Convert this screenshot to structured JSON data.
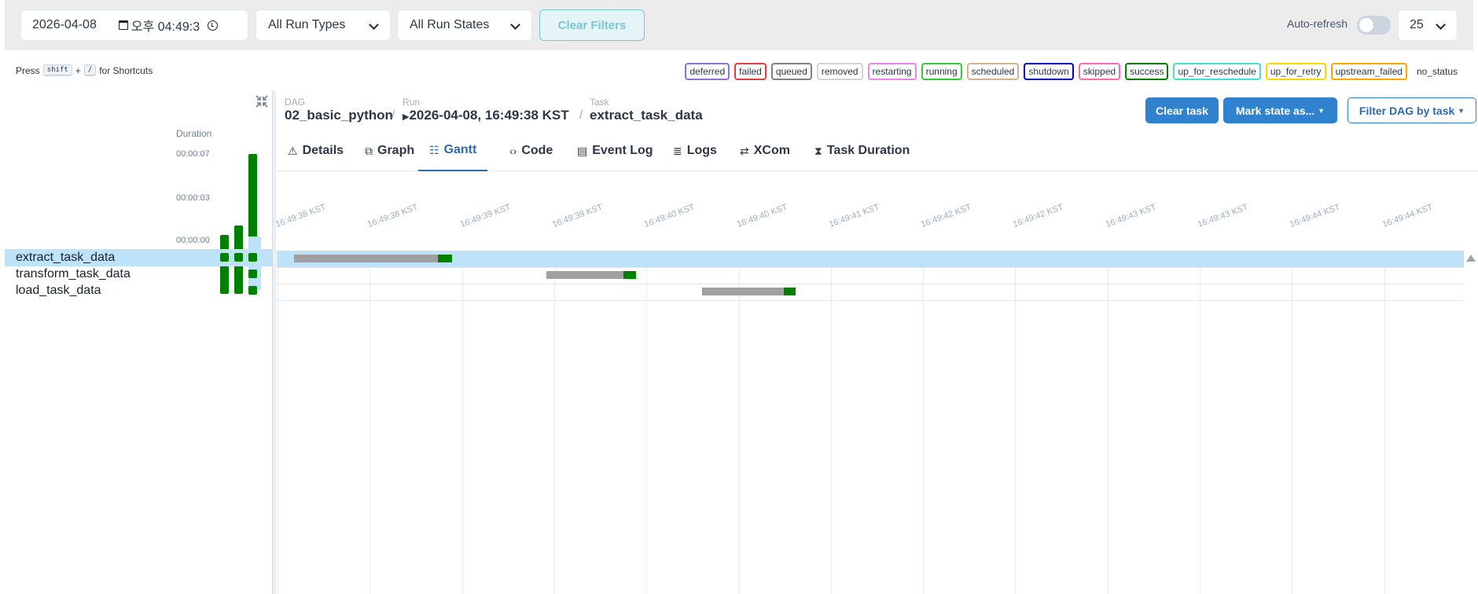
{
  "filters": {
    "date_value": "2026-04-08",
    "time_value": "오후 04:49:3",
    "run_types": "All Run Types",
    "run_states": "All Run States",
    "clear_label": "Clear Filters",
    "autorefresh_label": "Auto-refresh",
    "autorefresh_on": false,
    "count_value": "25"
  },
  "shortcut": {
    "press": "Press",
    "key1": "shift",
    "plus": "+",
    "key2": "/",
    "suffix": "for Shortcuts"
  },
  "legend": [
    {
      "label": "deferred",
      "color": "#9370db"
    },
    {
      "label": "failed",
      "color": "#e53e3e"
    },
    {
      "label": "queued",
      "color": "#808080"
    },
    {
      "label": "removed",
      "color": "#d3d3d3"
    },
    {
      "label": "restarting",
      "color": "#ee82ee"
    },
    {
      "label": "running",
      "color": "#32cd32"
    },
    {
      "label": "scheduled",
      "color": "#d2b48c"
    },
    {
      "label": "shutdown",
      "color": "#0000cd"
    },
    {
      "label": "skipped",
      "color": "#ff69b4"
    },
    {
      "label": "success",
      "color": "#008000"
    },
    {
      "label": "up_for_reschedule",
      "color": "#40e0d0"
    },
    {
      "label": "up_for_retry",
      "color": "#ffd700"
    },
    {
      "label": "upstream_failed",
      "color": "#ffa500"
    },
    {
      "label": "no_status",
      "color": "transparent"
    }
  ],
  "grid": {
    "duration_label": "Duration",
    "ticks": [
      "00:00:07",
      "00:00:03",
      "00:00:00"
    ],
    "run_durations": [
      3.7,
      4.3,
      8.8
    ],
    "duration_max": 9.0,
    "tasks": [
      {
        "name": "extract_task_data",
        "runs": [
          true,
          true,
          true
        ],
        "selected": true
      },
      {
        "name": "transform_task_data",
        "runs": [
          true,
          true,
          true
        ],
        "selected": false
      },
      {
        "name": "load_task_data",
        "runs": [
          false,
          false,
          true
        ],
        "selected": false
      }
    ]
  },
  "breadcrumb": {
    "dag_label": "DAG",
    "dag_value": "02_basic_python",
    "run_label": "Run",
    "run_value": "2026-04-08, 16:49:38 KST",
    "task_label": "Task",
    "task_value": "extract_task_data",
    "sep": "/"
  },
  "actions": {
    "clear_task": "Clear task",
    "mark_state": "Mark state as...",
    "filter_dag": "Filter DAG by task"
  },
  "tabs": [
    {
      "label": "Details",
      "icon": "⚠"
    },
    {
      "label": "Graph",
      "icon": "⧉"
    },
    {
      "label": "Gantt",
      "icon": "☷"
    },
    {
      "label": "Code",
      "icon": "‹›"
    },
    {
      "label": "Event Log",
      "icon": "▤"
    },
    {
      "label": "Logs",
      "icon": "≣"
    },
    {
      "label": "XCom",
      "icon": "⇄"
    },
    {
      "label": "Task Duration",
      "icon": "⧗"
    }
  ],
  "active_tab": "Gantt",
  "gantt": {
    "time_labels": [
      "16:49:38 KST",
      "16:49:38 KST",
      "16:49:39 KST",
      "16:49:39 KST",
      "16:49:40 KST",
      "16:49:40 KST",
      "16:49:41 KST",
      "16:49:42 KST",
      "16:49:42 KST",
      "16:49:43 KST",
      "16:49:43 KST",
      "16:49:44 KST",
      "16:49:44 KST"
    ],
    "bars": [
      {
        "task": "extract_task_data",
        "queued_start": 0.19,
        "run_start": 1.75,
        "end": 1.9
      },
      {
        "task": "transform_task_data",
        "queued_start": 2.92,
        "run_start": 3.76,
        "end": 3.9
      },
      {
        "task": "load_task_data",
        "queued_start": 4.61,
        "run_start": 5.5,
        "end": 5.63
      }
    ],
    "tick_seconds": 0.5
  }
}
